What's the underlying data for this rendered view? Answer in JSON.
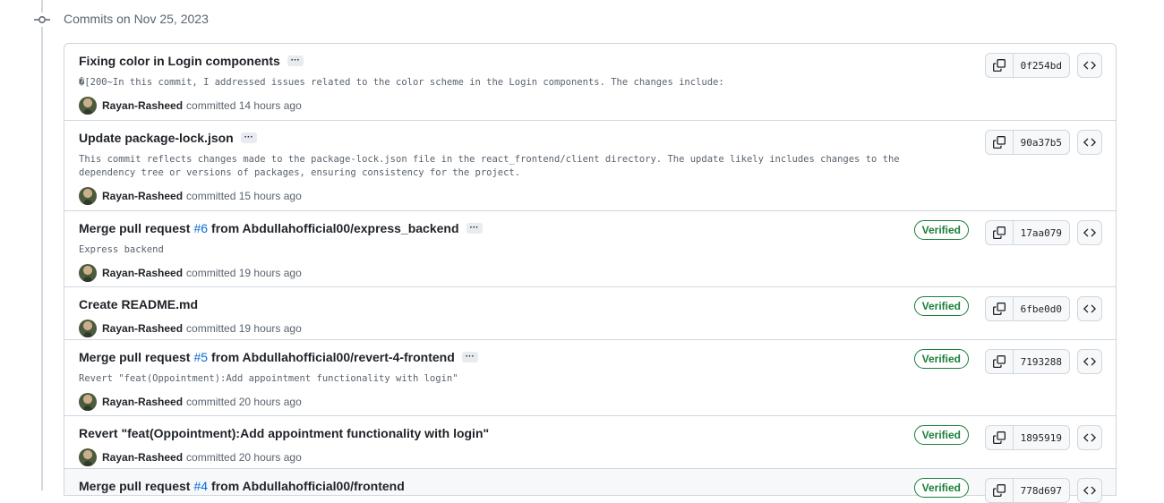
{
  "group": {
    "title": "Commits on Nov 25, 2023"
  },
  "commits": [
    {
      "title_prefix": "Fixing color in Login components",
      "pr_link": "",
      "title_suffix": "",
      "description": "�[200~In this commit, I addressed issues related to the color scheme in the Login components. The changes include:",
      "author": "Rayan-Rasheed",
      "meta": "committed 14 hours ago",
      "verified": "",
      "sha": "0f254bd"
    },
    {
      "title_prefix": "Update package-lock.json",
      "pr_link": "",
      "title_suffix": "",
      "description": "This commit reflects changes made to the package-lock.json file in the react_frontend/client directory. The update likely includes changes to the\ndependency tree or versions of packages, ensuring consistency for the project.",
      "author": "Rayan-Rasheed",
      "meta": "committed 15 hours ago",
      "verified": "",
      "sha": "90a37b5"
    },
    {
      "title_prefix": "Merge pull request",
      "pr_link": "#6",
      "title_suffix": "from Abdullahofficial00/express_backend",
      "description": "Express backend",
      "author": "Rayan-Rasheed",
      "meta": "committed 19 hours ago",
      "verified": "Verified",
      "sha": "17aa079"
    },
    {
      "title_prefix": "Create README.md",
      "pr_link": "",
      "title_suffix": "",
      "description": "",
      "author": "Rayan-Rasheed",
      "meta": "committed 19 hours ago",
      "verified": "Verified",
      "sha": "6fbe0d0"
    },
    {
      "title_prefix": "Merge pull request",
      "pr_link": "#5",
      "title_suffix": "from Abdullahofficial00/revert-4-frontend",
      "description": "Revert \"feat(Oppointment):Add appointment functionality with login\"",
      "author": "Rayan-Rasheed",
      "meta": "committed 20 hours ago",
      "verified": "Verified",
      "sha": "7193288"
    },
    {
      "title_prefix": "Revert \"feat(Oppointment):Add appointment functionality with login\"",
      "pr_link": "",
      "title_suffix": "",
      "description": "",
      "author": "Rayan-Rasheed",
      "meta": "committed 20 hours ago",
      "verified": "Verified",
      "sha": "1895919"
    },
    {
      "title_prefix": "Merge pull request",
      "pr_link": "#4",
      "title_suffix": "from Abdullahofficial00/frontend",
      "description": "",
      "author": "",
      "meta": "",
      "verified": "Verified",
      "sha": "778d697"
    }
  ],
  "icons": {
    "commit": "git-commit-icon",
    "copy": "copy-icon",
    "browse": "code-brackets-icon",
    "more": "ellipsis-icon"
  },
  "colors": {
    "link": "#0969da",
    "verified": "#1a7f37",
    "border": "#d0d7de"
  }
}
